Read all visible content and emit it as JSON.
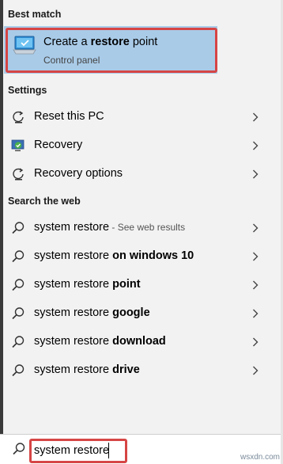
{
  "best_match": {
    "heading": "Best match",
    "title_prefix": "Create a ",
    "title_bold": "restore",
    "title_suffix": " point",
    "subtitle": "Control panel",
    "icon": "restore-point-monitor-icon"
  },
  "settings": {
    "heading": "Settings",
    "items": [
      {
        "label": "Reset this PC",
        "icon": "reset-pc-icon"
      },
      {
        "label": "Recovery",
        "icon": "recovery-shield-icon"
      },
      {
        "label": "Recovery options",
        "icon": "recovery-options-icon"
      }
    ]
  },
  "web": {
    "heading": "Search the web",
    "items": [
      {
        "normal": "system restore",
        "bold": "",
        "hint": " - See web results"
      },
      {
        "normal": "system restore ",
        "bold": "on windows 10",
        "hint": ""
      },
      {
        "normal": "system restore ",
        "bold": "point",
        "hint": ""
      },
      {
        "normal": "system restore ",
        "bold": "google",
        "hint": ""
      },
      {
        "normal": "system restore ",
        "bold": "download",
        "hint": ""
      },
      {
        "normal": "system restore ",
        "bold": "drive",
        "hint": ""
      }
    ]
  },
  "search": {
    "value": "system restore",
    "icon": "search-icon"
  },
  "watermark": "wsxdn.com",
  "colors": {
    "highlight": "#a9cbe8",
    "annotation_red": "#d64545",
    "panel_bg": "#f2f2f2"
  }
}
